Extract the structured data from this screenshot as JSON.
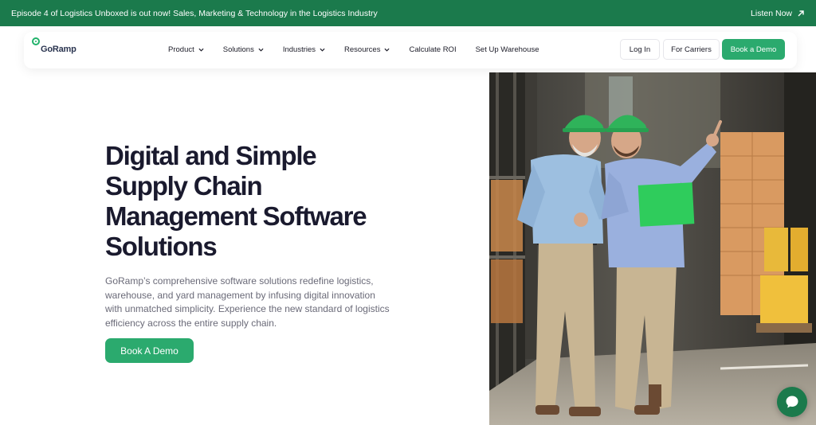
{
  "announcement": {
    "text": "Episode 4 of Logistics Unboxed is out now! Sales, Marketing & Technology in the Logistics Industry",
    "link_label": "Listen Now"
  },
  "header": {
    "logo_text": "GoRamp",
    "nav": [
      {
        "label": "Product",
        "dropdown": true
      },
      {
        "label": "Solutions",
        "dropdown": true
      },
      {
        "label": "Industries",
        "dropdown": true
      },
      {
        "label": "Resources",
        "dropdown": true
      },
      {
        "label": "Calculate ROI",
        "dropdown": false
      },
      {
        "label": "Set Up Warehouse",
        "dropdown": false
      }
    ],
    "login_label": "Log In",
    "carriers_label": "For Carriers",
    "demo_label": "Book a Demo"
  },
  "hero": {
    "title_lines": [
      "Digital and Simple",
      "Supply Chain",
      "Management Software",
      "Solutions"
    ],
    "description": "GoRamp’s comprehensive software solutions redefine logistics, warehouse, and yard management by infusing digital innovation with unmatched simplicity. Experience the new standard of logistics efficiency across the entire supply chain.",
    "cta_label": "Book A Demo"
  },
  "colors": {
    "brand_dark": "#1b7a4c",
    "brand_green": "#2baa6e"
  },
  "icons": {
    "announce_link": "arrow-up-right-icon",
    "nav_dropdown": "chevron-down-icon",
    "chat": "chat-bubble-icon"
  }
}
